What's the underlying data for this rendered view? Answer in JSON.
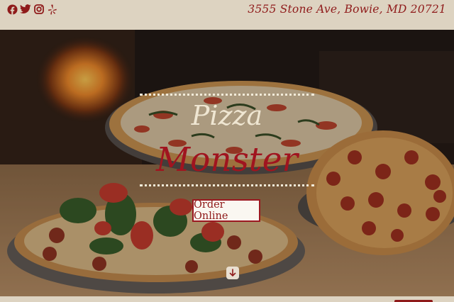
{
  "header": {
    "address": "3555 Stone Ave, Bowie, MD 20721",
    "social_icons": [
      "facebook-icon",
      "twitter-icon",
      "instagram-icon",
      "yelp-icon"
    ],
    "icon_color": "#8f1a1a"
  },
  "hero": {
    "brand_top": "Pizza",
    "brand_main": "Monster",
    "order_label": "Order Online",
    "accent_color": "#a0141f"
  }
}
